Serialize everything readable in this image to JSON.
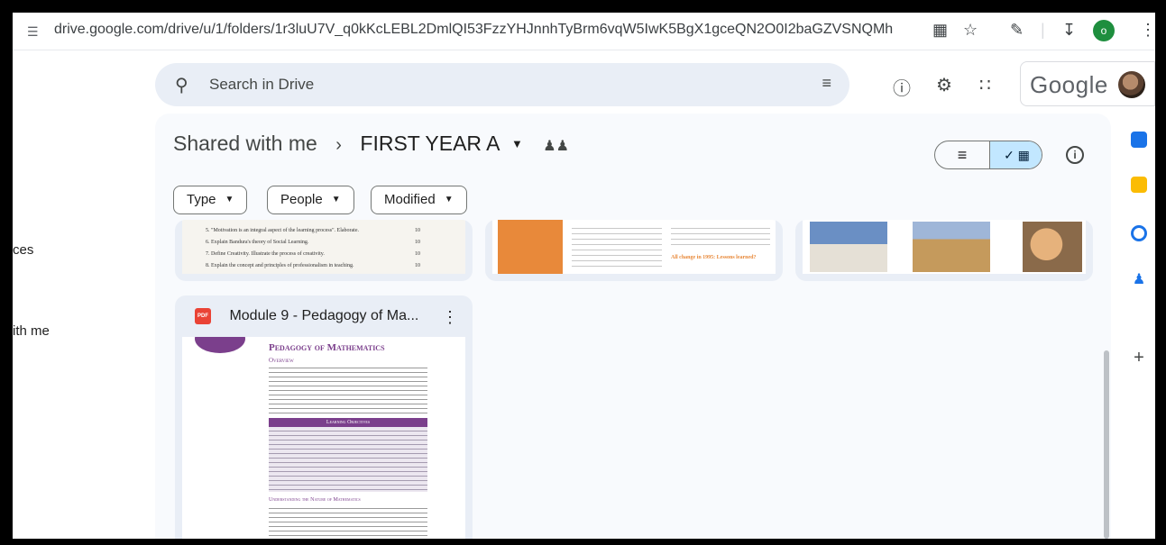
{
  "browser": {
    "url": "drive.google.com/drive/u/1/folders/1r3luU7V_q0kKcLEBL2DmlQI53FzzYHJnnhTyBrm6vqW5IwK5BgX1gceQN2O0I2baGZVSNQMh",
    "profile_initial": "o"
  },
  "search": {
    "placeholder": "Search in Drive"
  },
  "header": {
    "brand": "Google"
  },
  "nav": {
    "item_a": "ces",
    "item_b": "ith me"
  },
  "breadcrumb": {
    "parent": "Shared with me",
    "current": "FIRST YEAR A"
  },
  "filters": {
    "type": "Type",
    "people": "People",
    "modified": "Modified"
  },
  "files": [
    {
      "name": "Module 9 - Pedagogy of Ma...",
      "preview_title": "Pedagogy of Mathematics",
      "preview_overview": "Overview",
      "preview_objectives": "Learning Objectives",
      "preview_section": "Understanding the Nature of Mathematics"
    }
  ],
  "card1_lines": [
    "5.  \"Motivation is an integral aspect of the learning process\". Elaborate.",
    "6.  Explain Bandura's theory of Social Learning.",
    "7.  Define Creativity. Illustrate the process of creativity.",
    "8.  Explain the concept and principles of professionalism in teaching."
  ],
  "card1_marks": [
    "10",
    "10",
    "10",
    "10"
  ],
  "card2_heading": "All change in 1995: Lessons learned?",
  "colors": {
    "accent": "#c2e7ff",
    "pdf_red": "#ea4335",
    "purple": "#7b3f8c"
  }
}
